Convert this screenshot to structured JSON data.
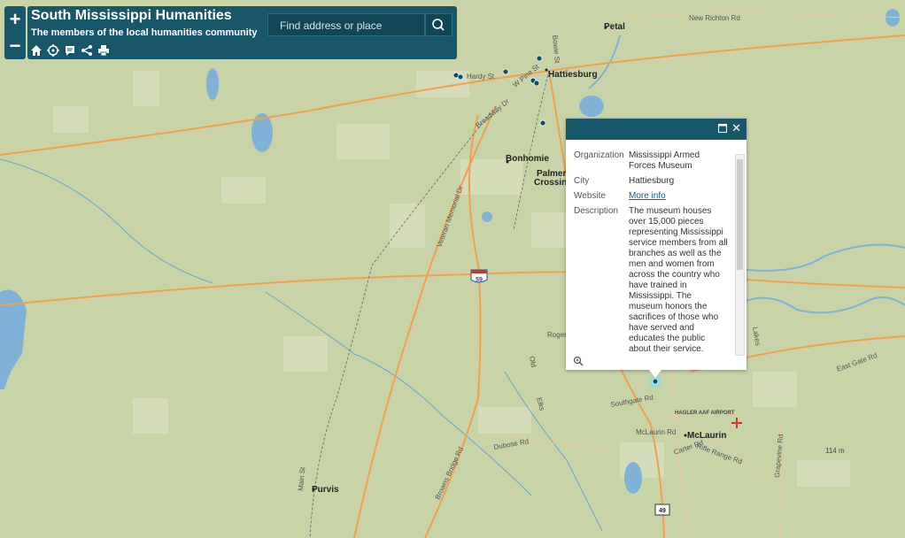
{
  "app": {
    "title": "South Mississippi Humanities",
    "subtitle": "The members of the local humanities community"
  },
  "zoom": {
    "in_label": "+",
    "out_label": "−"
  },
  "search": {
    "placeholder": "Find address or place"
  },
  "toolbar": {
    "icons": [
      "home-icon",
      "locate-icon",
      "description-icon",
      "share-icon",
      "print-icon"
    ]
  },
  "popup": {
    "fields": [
      {
        "key": "Organization",
        "value": "Mississippi Armed Forces Museum"
      },
      {
        "key": "City",
        "value": "Hattiesburg"
      },
      {
        "key": "Website",
        "value": "More info"
      },
      {
        "key": "Description",
        "value": "The museum houses over 15,000 pieces representing Mississippi service members from all branches as well as the men and women from across the country who have trained in Mississippi. The museum honors the sacrifices of those who have served and educates the public about their service."
      }
    ]
  },
  "map": {
    "towns": [
      "Petal",
      "Hattiesburg",
      "Bonhomie",
      "Palmer",
      "Crossing",
      "McLaurin",
      "Purvis"
    ],
    "roads": [
      "New Richton Rd",
      "Hardy St",
      "W Pine St",
      "Broadway Dr",
      "Veteran Memorial Dr",
      "Rogers",
      "Southgate Rd",
      "McLaurin Rd",
      "Carter Rd",
      "Rifle Range Rd",
      "Dubose Rd",
      "Browns Bridge Rd",
      "Main St",
      "Elks",
      "Old",
      "East Gate Rd",
      "Grapevine Rd",
      "Bowie St",
      "Lakes"
    ],
    "shields": [
      "59",
      "49"
    ],
    "airport": "HAGLER AAF AIRPORT",
    "elevation": "114 m"
  },
  "colors": {
    "header": "#18566a",
    "water": "#7fb2d6",
    "land": "#c9d3a8",
    "road": "#f0a050",
    "marker": "#114e6a"
  }
}
